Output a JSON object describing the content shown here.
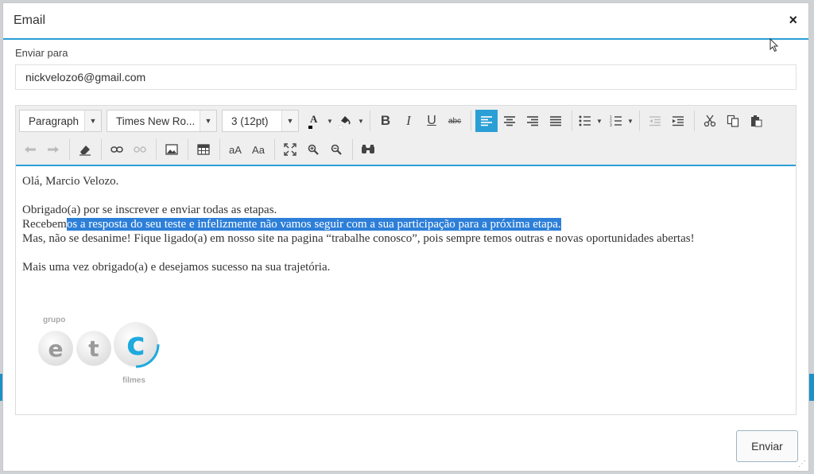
{
  "dialog": {
    "title": "Email",
    "close_label": "×",
    "to_label": "Enviar para",
    "to_value": "nickvelozo6@gmail.com",
    "send_label": "Enviar"
  },
  "toolbar": {
    "block_format": "Paragraph",
    "font_family": "Times New Ro...",
    "font_size": "3 (12pt)",
    "text_size_small": "aA",
    "text_size_title": "Aa",
    "icons_row1": [
      "font-color-icon",
      "highlight-color-icon",
      "bold-icon",
      "italic-icon",
      "underline-icon",
      "strikethrough-icon",
      "align-left-icon",
      "align-center-icon",
      "align-right-icon",
      "align-justify-icon",
      "bullet-list-icon",
      "numbered-list-icon",
      "outdent-icon",
      "indent-icon",
      "cut-icon",
      "copy-icon",
      "paste-icon"
    ],
    "icons_row2": [
      "undo-icon",
      "redo-icon",
      "eraser-icon",
      "link-icon",
      "unlink-icon",
      "image-icon",
      "table-icon",
      "fullscreen-icon",
      "zoom-in-icon",
      "zoom-out-icon",
      "find-icon"
    ]
  },
  "body": {
    "greeting": "Olá, Marcio Velozo.",
    "line1": "Obrigado(a) por se inscrever e enviar todas as etapas.",
    "line2_pre": "Recebem",
    "line2_sel": "os a resposta do seu teste e infelizmente não vamos seguir com a sua participação para a próxima etapa.",
    "line3": "Mas, não se desanime! Fique ligado(a) em nosso site na pagina “trabalhe conosco”, pois sempre temos outras e novas oportunidades abertas!",
    "line4": "Mais uma vez obrigado(a) e desejamos sucesso na sua trajetória."
  },
  "logo": {
    "top_text": "grupo",
    "letters": [
      "e",
      "t",
      "c"
    ],
    "bottom_text": "filmes",
    "accent": "#1eaadf"
  },
  "colors": {
    "accent": "#2a9fd6",
    "selection": "#2d7fd8"
  }
}
